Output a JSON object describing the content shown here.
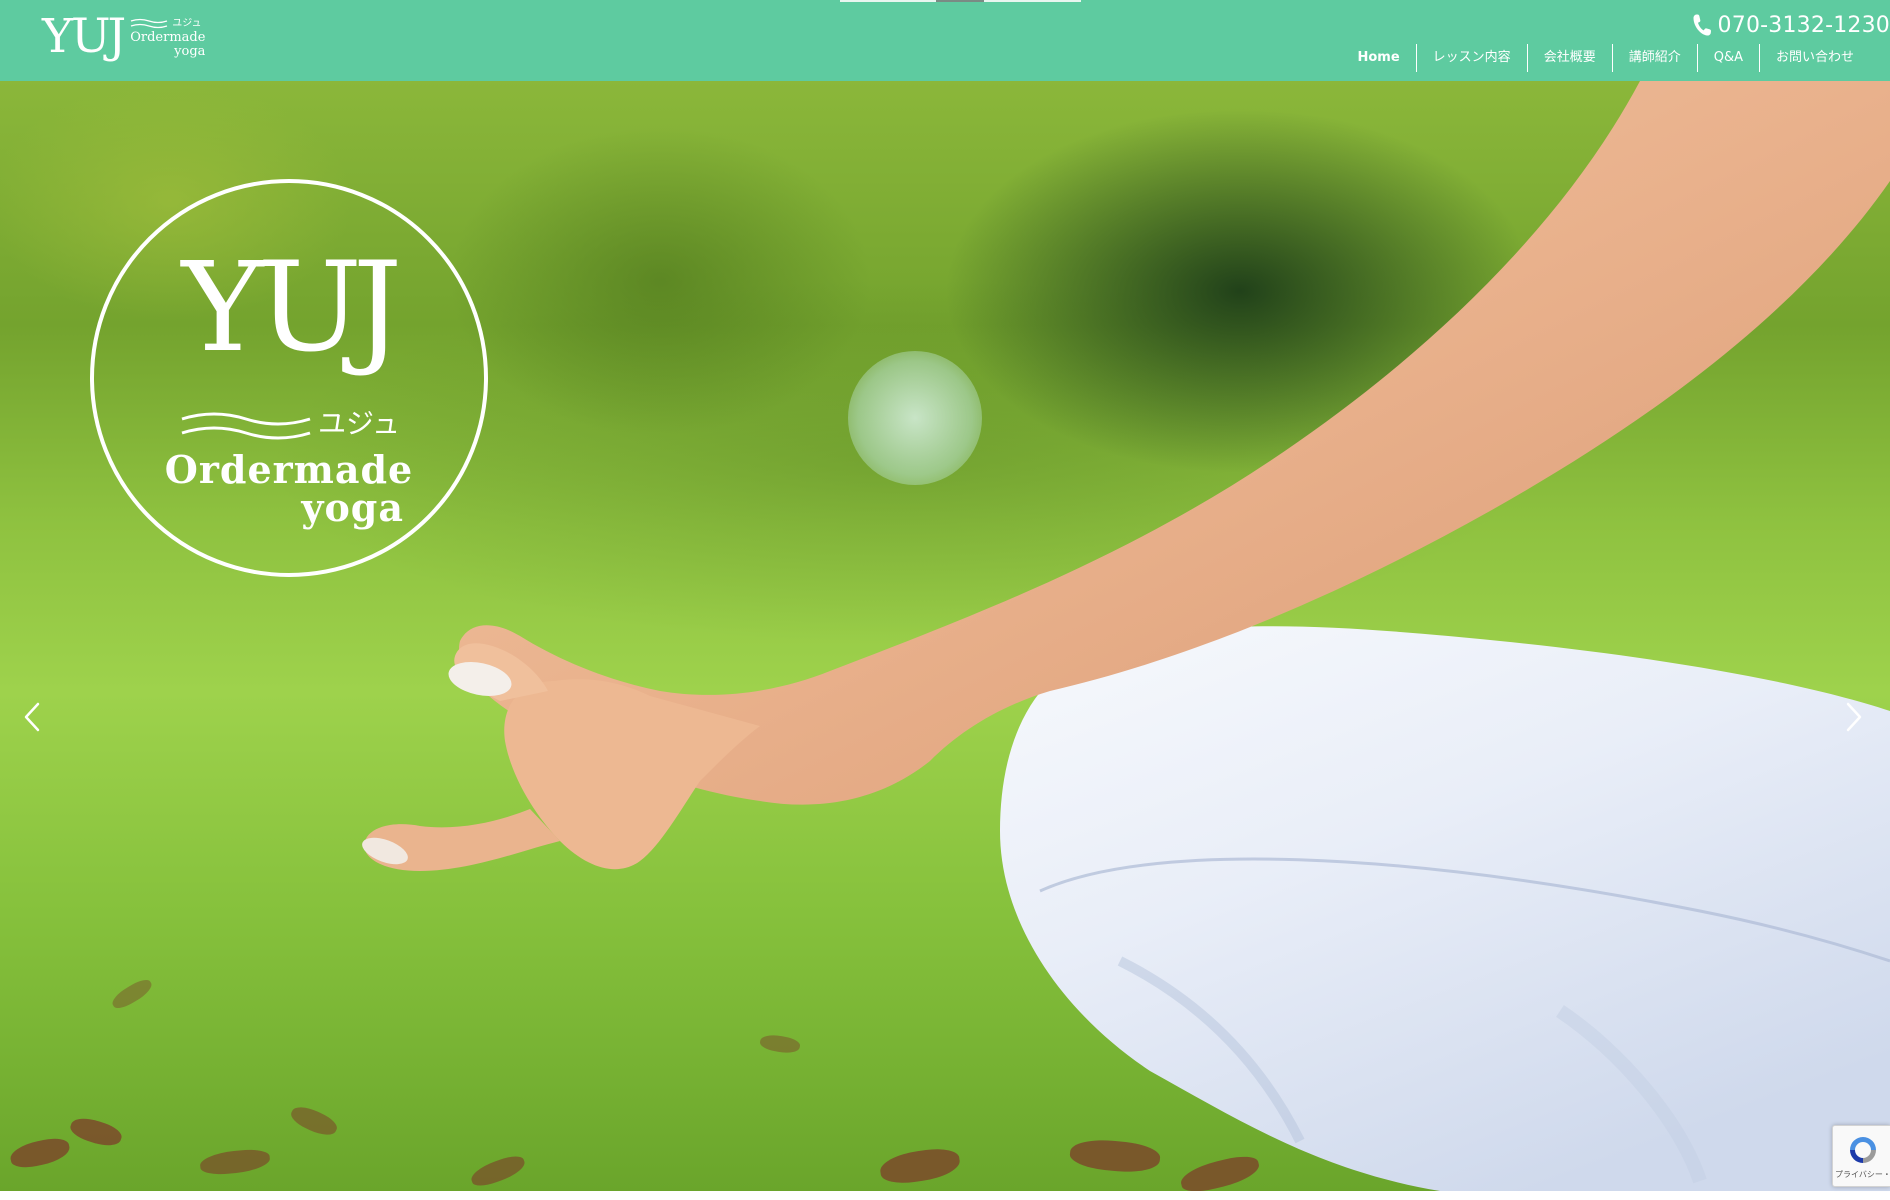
{
  "header": {
    "logo": {
      "name": "YUJ",
      "kana": "ユジュ",
      "line1": "Ordermade",
      "line2": "yoga"
    },
    "phone": {
      "icon": "phone-icon",
      "number": "070-3132-1230"
    },
    "nav": [
      {
        "label": "Home"
      },
      {
        "label": "レッスン内容"
      },
      {
        "label": "会社概要"
      },
      {
        "label": "講師紹介"
      },
      {
        "label": "Q&A"
      },
      {
        "label": "お問い合わせ"
      }
    ]
  },
  "hero": {
    "seal": {
      "name": "YUJ",
      "kana": "ユジュ",
      "line1": "Ordermade",
      "line2": "yoga"
    },
    "prev_icon": "chevron-left-icon",
    "next_icon": "chevron-right-icon"
  },
  "recaptcha": {
    "icon": "recaptcha-icon",
    "text": "プライバシー・利用規約"
  },
  "colors": {
    "header_bg": "#5ecba0",
    "text_on_header": "#ffffff"
  }
}
